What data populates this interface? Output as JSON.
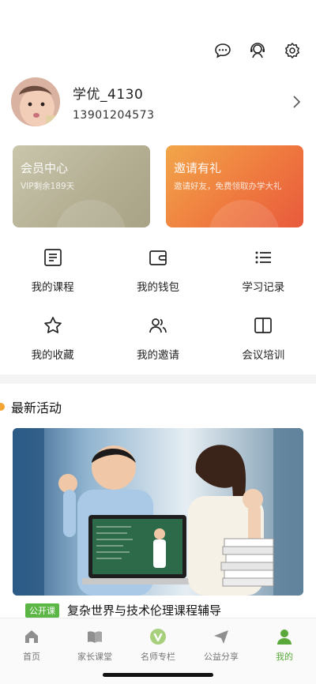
{
  "header": {
    "icons": [
      "message-icon",
      "service-icon",
      "settings-icon"
    ]
  },
  "profile": {
    "username": "学优_4130",
    "phone": "13901204573"
  },
  "cards": {
    "vip": {
      "title": "会员中心",
      "subtitle": "VIP剩余189天"
    },
    "invite": {
      "title": "邀请有礼",
      "subtitle": "邀请好友，免费领取办学大礼"
    }
  },
  "menu": [
    {
      "label": "我的课程",
      "icon": "course-icon"
    },
    {
      "label": "我的钱包",
      "icon": "wallet-icon"
    },
    {
      "label": "学习记录",
      "icon": "list-icon"
    },
    {
      "label": "我的收藏",
      "icon": "star-icon"
    },
    {
      "label": "我的邀请",
      "icon": "users-icon"
    },
    {
      "label": "会议培训",
      "icon": "book-icon"
    }
  ],
  "activities": {
    "title": "最新活动",
    "items": [
      {
        "tag": "公开课",
        "title": "复杂世界与技术伦理课程辅导"
      }
    ]
  },
  "tabs": [
    {
      "label": "首页",
      "icon": "home-icon"
    },
    {
      "label": "家长课堂",
      "icon": "book-open-icon"
    },
    {
      "label": "名师专栏",
      "icon": "v-badge-icon"
    },
    {
      "label": "公益分享",
      "icon": "send-icon"
    },
    {
      "label": "我的",
      "icon": "person-icon"
    }
  ],
  "colors": {
    "accent": "#5aa83a",
    "tag": "#5cb646",
    "dot": "#f2a531",
    "vip_card": "#bbb69a",
    "invite_card": "#ee7a40"
  }
}
